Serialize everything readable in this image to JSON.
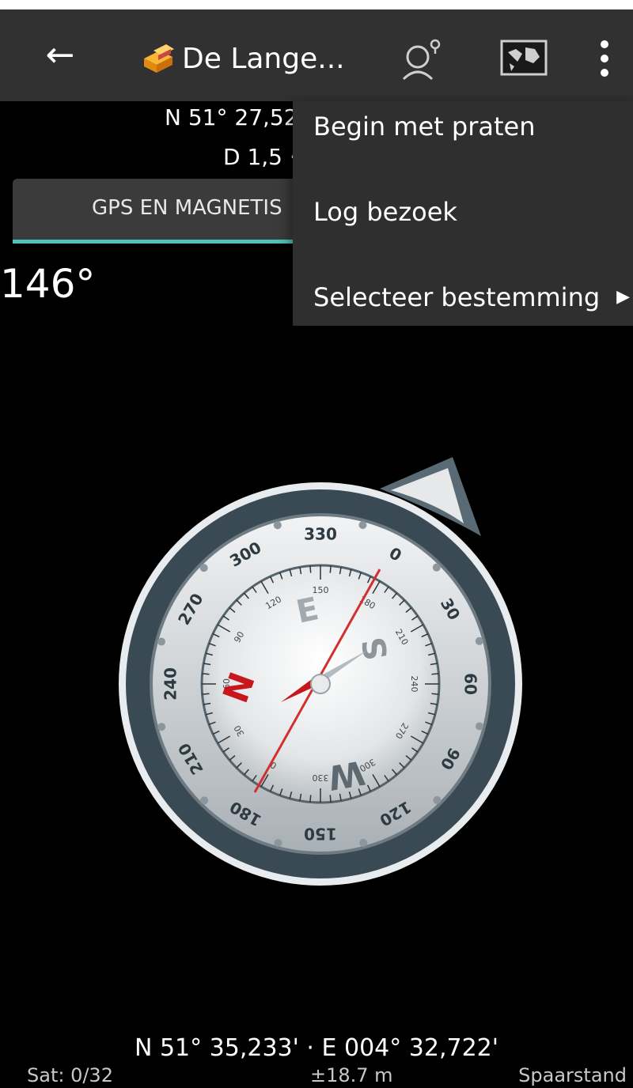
{
  "toolbar": {
    "back_icon": "arrow-left-icon",
    "title": "De Lange...",
    "speak_icon": "speak-icon",
    "map_icon": "map-icon",
    "more_icon": "more-vert-icon"
  },
  "info": {
    "coordinates": "N 51° 27,52",
    "distance": "D 1,5 ·"
  },
  "tab": {
    "label": "GPS EN MAGNETIS"
  },
  "heading": "146°",
  "menu": {
    "items": [
      {
        "label": "Begin met praten"
      },
      {
        "label": "Log bezoek"
      },
      {
        "label": "Selecteer bestemming",
        "submenu_icon": "triangle-right-icon"
      }
    ]
  },
  "compass": {
    "bezel_labels": [
      "330",
      "0",
      "30",
      "60",
      "90",
      "120",
      "150",
      "180",
      "210",
      "240",
      "270",
      "300"
    ],
    "inner_labels": [
      "120",
      "150",
      "180",
      "210",
      "240",
      "270",
      "300",
      "330",
      "0",
      "30",
      "60",
      "90"
    ],
    "cardinals": {
      "n": "N",
      "e": "E",
      "s": "S",
      "w": "W"
    }
  },
  "footer": {
    "position": "N 51° 35,233' · E 004° 32,722'",
    "satellites": "Sat: 0/32",
    "accuracy": "±18.7 m",
    "mode": "Spaarstand"
  },
  "colors": {
    "toolbar_bg": "#313131",
    "menu_bg": "#2f2f2f",
    "tab_accent": "#4fc3b8",
    "needle_north": "#c8161d"
  }
}
